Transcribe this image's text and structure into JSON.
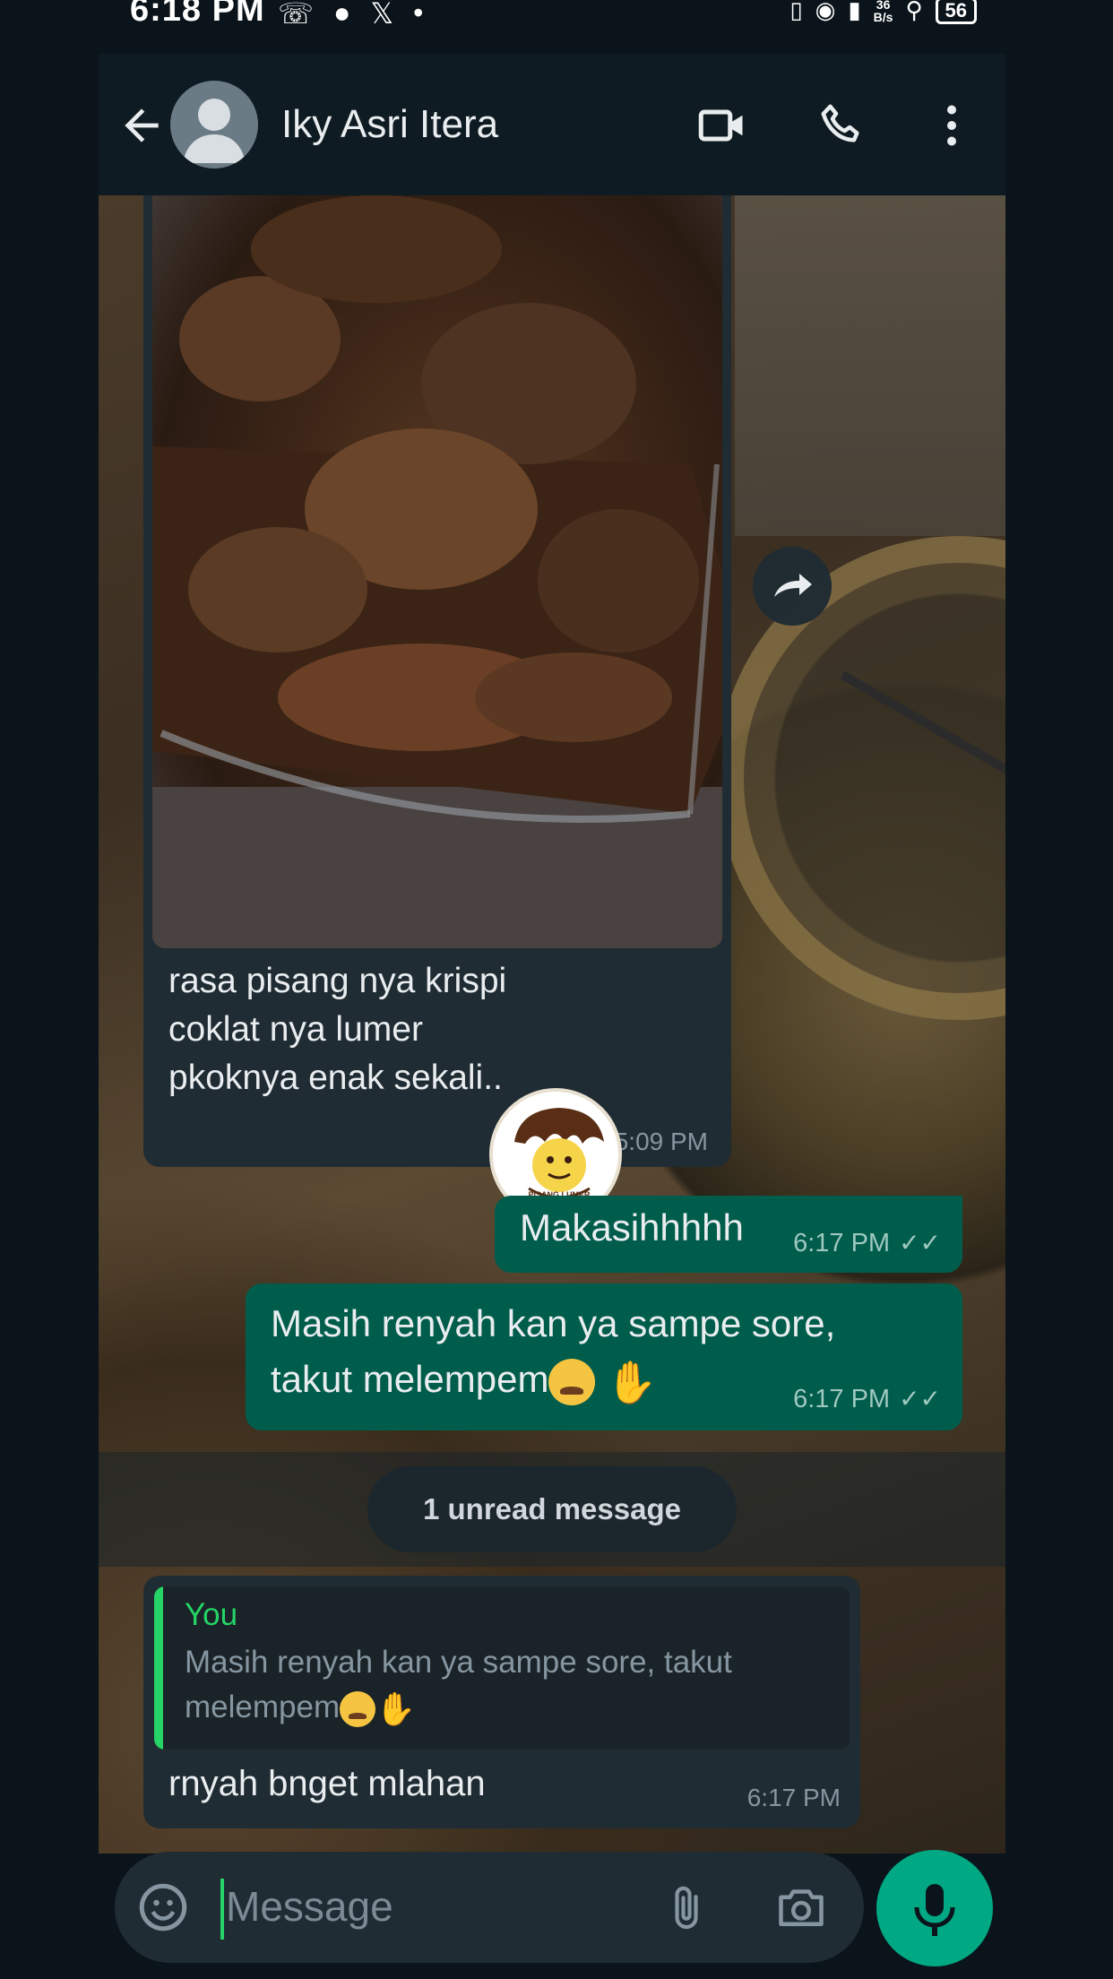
{
  "status_bar": {
    "time": "6:18 PM",
    "battery": "56",
    "net_speed_top": "36",
    "net_speed_bottom": "B/s"
  },
  "header": {
    "contact_name": "Iky Asri Itera"
  },
  "messages": {
    "photo_caption": "rasa pisang nya krispi\ncoklat nya lumer\npkoknya enak sekali..",
    "photo_time": "5:09 PM",
    "sticker_text": "PISANG LUMER",
    "out1_text": "Makasihhhhh",
    "out1_time": "6:17 PM",
    "out2_text": "Masih renyah kan ya sampe sore,\ntakut melempem",
    "out2_time": "6:17 PM",
    "unread_label": "1 unread message",
    "reply_quote_author": "You",
    "reply_quote_text": "Masih renyah kan ya sampe sore, takut melempem",
    "reply_text": "rnyah bnget mlahan",
    "reply_time": "6:17 PM"
  },
  "composer": {
    "placeholder": "Message"
  },
  "colors": {
    "accent_green": "#25d366",
    "outgoing_bubble": "#005c4b",
    "incoming_bubble": "#202c33"
  }
}
